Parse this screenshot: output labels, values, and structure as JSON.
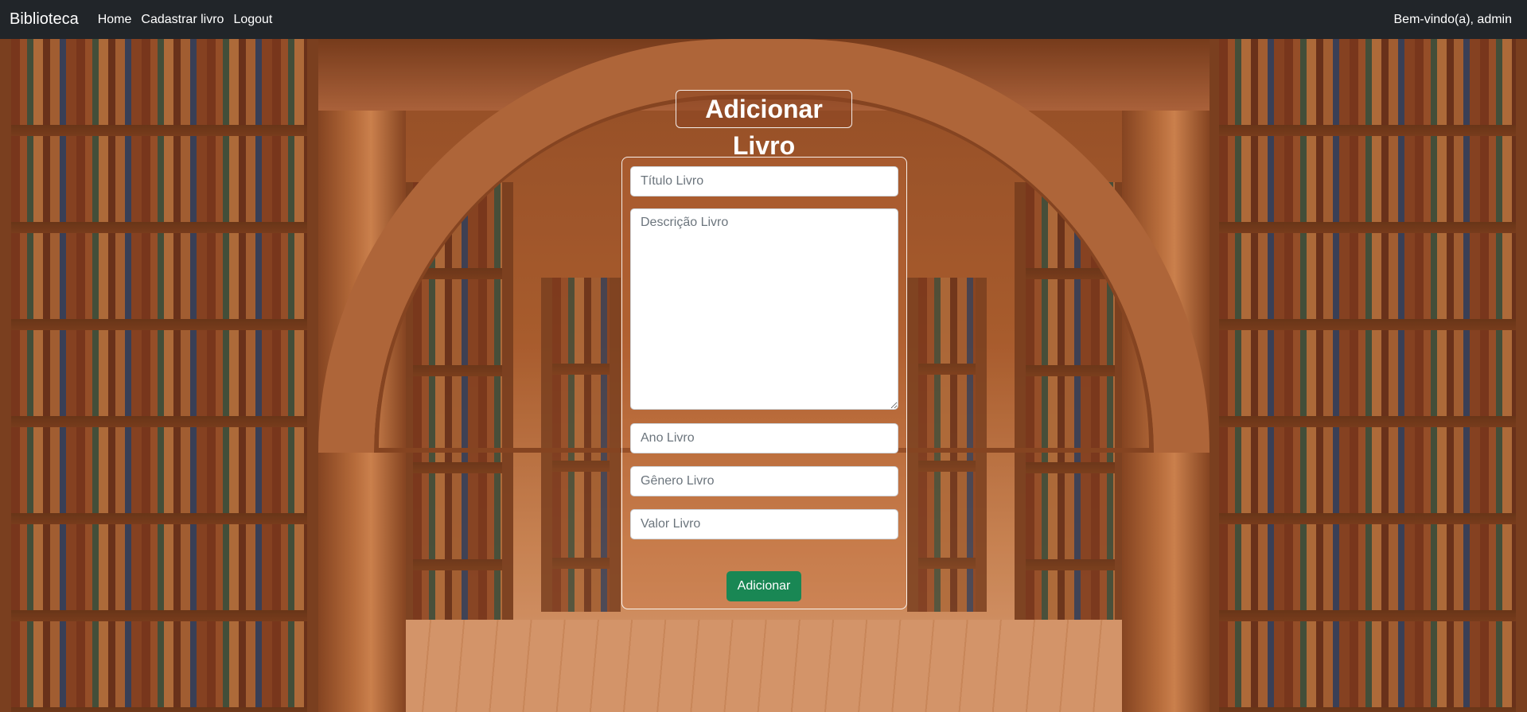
{
  "navbar": {
    "brand": "Biblioteca",
    "links": [
      "Home",
      "Cadastrar livro",
      "Logout"
    ],
    "welcome": "Bem-vindo(a), admin"
  },
  "form": {
    "heading": "Adicionar Livro",
    "fields": {
      "titulo": {
        "placeholder": "Título Livro",
        "value": ""
      },
      "descricao": {
        "placeholder": "Descrição Livro",
        "value": ""
      },
      "ano": {
        "placeholder": "Ano Livro",
        "value": ""
      },
      "genero": {
        "placeholder": "Gênero Livro",
        "value": ""
      },
      "valor": {
        "placeholder": "Valor Livro",
        "value": ""
      }
    },
    "submit_label": "Adicionar"
  },
  "colors": {
    "navbar_bg": "#212529",
    "submit_bg": "#198754"
  }
}
